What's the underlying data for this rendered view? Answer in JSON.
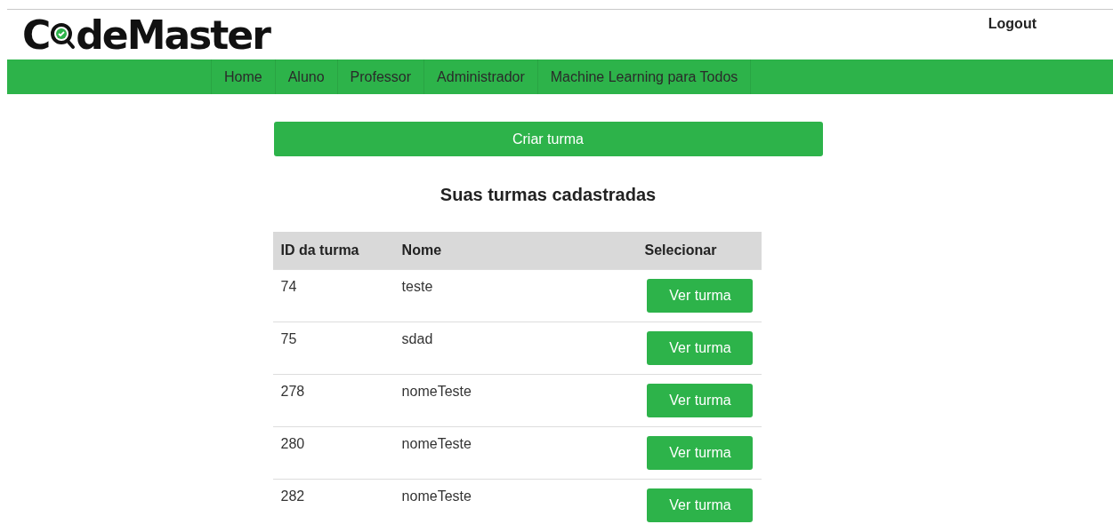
{
  "logo": {
    "before": "C",
    "after": "deMaster"
  },
  "logout": "Logout",
  "nav": [
    "Home",
    "Aluno",
    "Professor",
    "Administrador",
    "Machine Learning para Todos"
  ],
  "create_button": "Criar turma",
  "title": "Suas turmas cadastradas",
  "table": {
    "columns": [
      "ID da turma",
      "Nome",
      "Selecionar"
    ],
    "rows": [
      {
        "id": "74",
        "name": "teste",
        "action": "Ver turma"
      },
      {
        "id": "75",
        "name": "sdad",
        "action": "Ver turma"
      },
      {
        "id": "278",
        "name": "nomeTeste",
        "action": "Ver turma"
      },
      {
        "id": "280",
        "name": "nomeTeste",
        "action": "Ver turma"
      },
      {
        "id": "282",
        "name": "nomeTeste",
        "action": "Ver turma"
      }
    ]
  }
}
